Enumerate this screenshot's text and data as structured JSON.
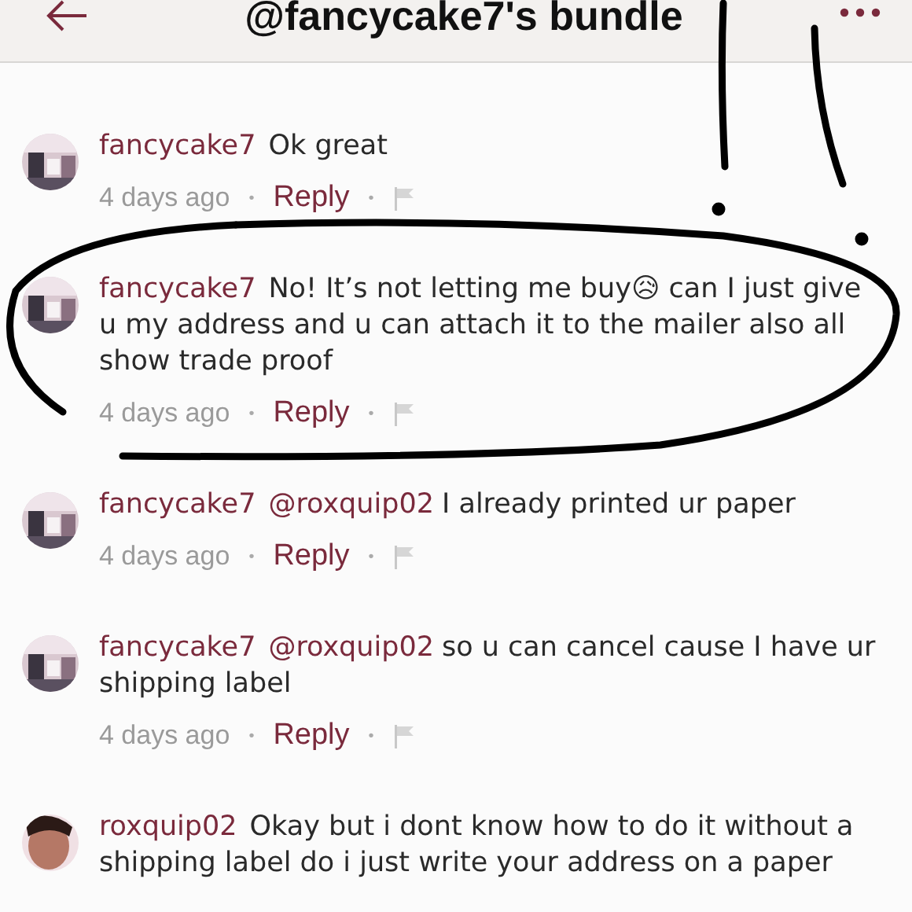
{
  "header": {
    "title": "@fancycake7's bundle"
  },
  "comments": [
    {
      "user": "fancycake7",
      "text": "Ok great",
      "time": "4 days ago",
      "reply": "Reply",
      "separator": "•"
    },
    {
      "user": "fancycake7",
      "text": "No! It’s not letting me buy😥 can I just give u my address and u can attach it to the mailer also all show trade proof",
      "time": "4 days ago",
      "reply": "Reply",
      "separator": "•"
    },
    {
      "user": "fancycake7",
      "mention": "@roxquip02",
      "text": "I already printed ur paper",
      "time": "4 days ago",
      "reply": "Reply",
      "separator": "•"
    },
    {
      "user": "fancycake7",
      "mention": "@roxquip02",
      "text": "so u can cancel cause I have ur shipping label",
      "time": "4 days ago",
      "reply": "Reply",
      "separator": "•"
    },
    {
      "user": "roxquip02",
      "text": "Okay but i dont know how to do it without a shipping label do i just write your address on a paper"
    }
  ]
}
